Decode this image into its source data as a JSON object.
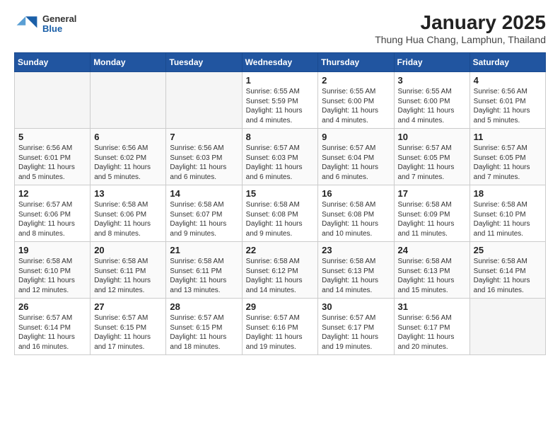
{
  "header": {
    "logo": {
      "general": "General",
      "blue": "Blue"
    },
    "title": "January 2025",
    "location": "Thung Hua Chang, Lamphun, Thailand"
  },
  "calendar": {
    "days_of_week": [
      "Sunday",
      "Monday",
      "Tuesday",
      "Wednesday",
      "Thursday",
      "Friday",
      "Saturday"
    ],
    "weeks": [
      [
        {
          "day": null
        },
        {
          "day": null
        },
        {
          "day": null
        },
        {
          "day": "1",
          "sunrise": "6:55 AM",
          "sunset": "5:59 PM",
          "daylight": "11 hours and 4 minutes."
        },
        {
          "day": "2",
          "sunrise": "6:55 AM",
          "sunset": "6:00 PM",
          "daylight": "11 hours and 4 minutes."
        },
        {
          "day": "3",
          "sunrise": "6:55 AM",
          "sunset": "6:00 PM",
          "daylight": "11 hours and 4 minutes."
        },
        {
          "day": "4",
          "sunrise": "6:56 AM",
          "sunset": "6:01 PM",
          "daylight": "11 hours and 5 minutes."
        }
      ],
      [
        {
          "day": "5",
          "sunrise": "6:56 AM",
          "sunset": "6:01 PM",
          "daylight": "11 hours and 5 minutes."
        },
        {
          "day": "6",
          "sunrise": "6:56 AM",
          "sunset": "6:02 PM",
          "daylight": "11 hours and 5 minutes."
        },
        {
          "day": "7",
          "sunrise": "6:56 AM",
          "sunset": "6:03 PM",
          "daylight": "11 hours and 6 minutes."
        },
        {
          "day": "8",
          "sunrise": "6:57 AM",
          "sunset": "6:03 PM",
          "daylight": "11 hours and 6 minutes."
        },
        {
          "day": "9",
          "sunrise": "6:57 AM",
          "sunset": "6:04 PM",
          "daylight": "11 hours and 6 minutes."
        },
        {
          "day": "10",
          "sunrise": "6:57 AM",
          "sunset": "6:05 PM",
          "daylight": "11 hours and 7 minutes."
        },
        {
          "day": "11",
          "sunrise": "6:57 AM",
          "sunset": "6:05 PM",
          "daylight": "11 hours and 7 minutes."
        }
      ],
      [
        {
          "day": "12",
          "sunrise": "6:57 AM",
          "sunset": "6:06 PM",
          "daylight": "11 hours and 8 minutes."
        },
        {
          "day": "13",
          "sunrise": "6:58 AM",
          "sunset": "6:06 PM",
          "daylight": "11 hours and 8 minutes."
        },
        {
          "day": "14",
          "sunrise": "6:58 AM",
          "sunset": "6:07 PM",
          "daylight": "11 hours and 9 minutes."
        },
        {
          "day": "15",
          "sunrise": "6:58 AM",
          "sunset": "6:08 PM",
          "daylight": "11 hours and 9 minutes."
        },
        {
          "day": "16",
          "sunrise": "6:58 AM",
          "sunset": "6:08 PM",
          "daylight": "11 hours and 10 minutes."
        },
        {
          "day": "17",
          "sunrise": "6:58 AM",
          "sunset": "6:09 PM",
          "daylight": "11 hours and 11 minutes."
        },
        {
          "day": "18",
          "sunrise": "6:58 AM",
          "sunset": "6:10 PM",
          "daylight": "11 hours and 11 minutes."
        }
      ],
      [
        {
          "day": "19",
          "sunrise": "6:58 AM",
          "sunset": "6:10 PM",
          "daylight": "11 hours and 12 minutes."
        },
        {
          "day": "20",
          "sunrise": "6:58 AM",
          "sunset": "6:11 PM",
          "daylight": "11 hours and 12 minutes."
        },
        {
          "day": "21",
          "sunrise": "6:58 AM",
          "sunset": "6:11 PM",
          "daylight": "11 hours and 13 minutes."
        },
        {
          "day": "22",
          "sunrise": "6:58 AM",
          "sunset": "6:12 PM",
          "daylight": "11 hours and 14 minutes."
        },
        {
          "day": "23",
          "sunrise": "6:58 AM",
          "sunset": "6:13 PM",
          "daylight": "11 hours and 14 minutes."
        },
        {
          "day": "24",
          "sunrise": "6:58 AM",
          "sunset": "6:13 PM",
          "daylight": "11 hours and 15 minutes."
        },
        {
          "day": "25",
          "sunrise": "6:58 AM",
          "sunset": "6:14 PM",
          "daylight": "11 hours and 16 minutes."
        }
      ],
      [
        {
          "day": "26",
          "sunrise": "6:57 AM",
          "sunset": "6:14 PM",
          "daylight": "11 hours and 16 minutes."
        },
        {
          "day": "27",
          "sunrise": "6:57 AM",
          "sunset": "6:15 PM",
          "daylight": "11 hours and 17 minutes."
        },
        {
          "day": "28",
          "sunrise": "6:57 AM",
          "sunset": "6:15 PM",
          "daylight": "11 hours and 18 minutes."
        },
        {
          "day": "29",
          "sunrise": "6:57 AM",
          "sunset": "6:16 PM",
          "daylight": "11 hours and 19 minutes."
        },
        {
          "day": "30",
          "sunrise": "6:57 AM",
          "sunset": "6:17 PM",
          "daylight": "11 hours and 19 minutes."
        },
        {
          "day": "31",
          "sunrise": "6:56 AM",
          "sunset": "6:17 PM",
          "daylight": "11 hours and 20 minutes."
        },
        {
          "day": null
        }
      ]
    ]
  }
}
